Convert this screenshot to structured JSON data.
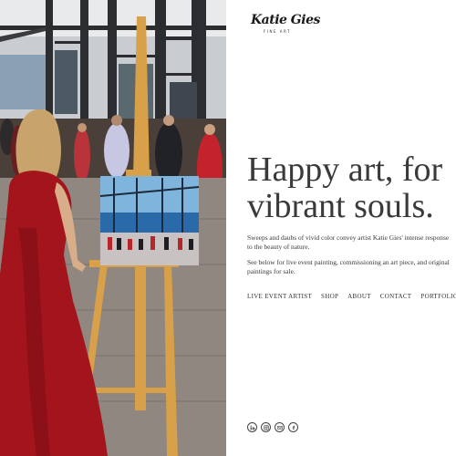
{
  "brand": {
    "logo_script": "Katie Gies",
    "logo_sub": "FINE ART"
  },
  "hero": {
    "headline": "Happy art, for vibrant souls.",
    "paragraph_1": "Sweeps and daubs of vivid color convey artist Katie Gies' intense response to the beauty of nature.",
    "paragraph_2": "See below for live event painting, commissioning an art piece, and original paintings for sale."
  },
  "nav": {
    "items": [
      {
        "label": "LIVE EVENT ARTIST"
      },
      {
        "label": "SHOP"
      },
      {
        "label": "ABOUT"
      },
      {
        "label": "CONTACT"
      },
      {
        "label": "PORTFOLIO"
      }
    ]
  },
  "social": {
    "icons": [
      "linkedin-icon",
      "instagram-icon",
      "email-icon",
      "facebook-icon"
    ]
  },
  "colors": {
    "dress_red": "#a3141c",
    "easel_wood": "#d9a04a",
    "paving": "#8f8780",
    "text": "#3a3a3a"
  }
}
